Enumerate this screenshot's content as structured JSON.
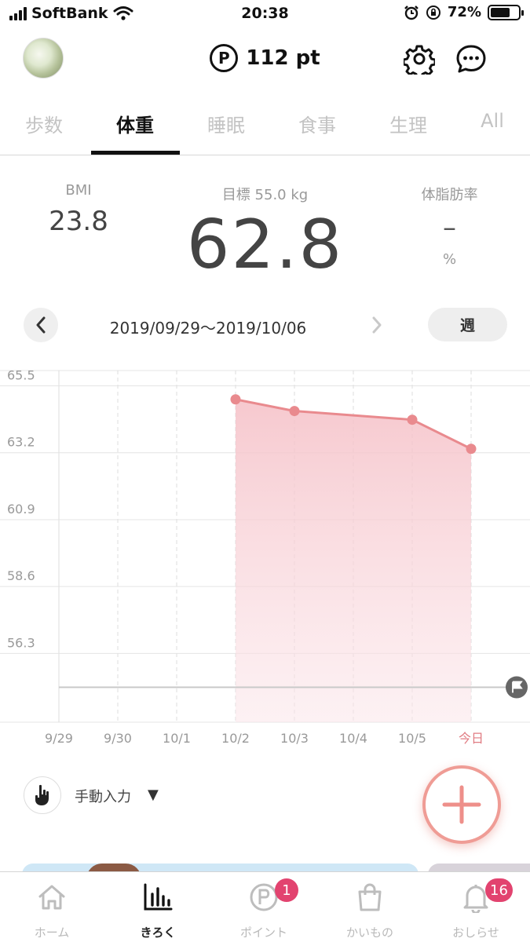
{
  "status_bar": {
    "carrier": "SoftBank",
    "time": "20:38",
    "battery_pct": "72%",
    "battery_level": 0.72
  },
  "header": {
    "points": "112 pt",
    "points_icon": "P"
  },
  "tabs": [
    {
      "label": "歩数"
    },
    {
      "label": "体重",
      "active": true
    },
    {
      "label": "睡眠"
    },
    {
      "label": "食事"
    },
    {
      "label": "生理"
    },
    {
      "label": "All"
    }
  ],
  "metrics": {
    "bmi_label": "BMI",
    "bmi_value": "23.8",
    "goal_label": "目標 55.0 kg",
    "weight_value": "62.8",
    "fat_label": "体脂肪率",
    "fat_value": "–",
    "fat_unit": "%"
  },
  "date_nav": {
    "range": "2019/09/29〜2019/10/06",
    "period": "週"
  },
  "chart_data": {
    "type": "area",
    "x": [
      "9/29",
      "9/30",
      "10/1",
      "10/2",
      "10/3",
      "10/4",
      "10/5",
      "今日"
    ],
    "y_ticks": [
      "65.5",
      "63.2",
      "60.9",
      "58.6",
      "56.3"
    ],
    "ylim": [
      53.8,
      66.0
    ],
    "goal": 55.0,
    "series": [
      {
        "points": [
          {
            "x": "10/2",
            "y": 64.9
          },
          {
            "x": "10/3",
            "y": 64.5
          },
          {
            "x": "10/5",
            "y": 64.2
          },
          {
            "x": "今日",
            "y": 63.2
          }
        ]
      }
    ],
    "colors": {
      "line": "#e98a8e",
      "fill": "#f7c9cf",
      "goal_line": "#c9c9c9",
      "today_label": "#e07b82"
    }
  },
  "manual": {
    "label": "手動入力",
    "arrow": "▼"
  },
  "bottom_nav": [
    {
      "label": "ホーム",
      "icon": "home-icon"
    },
    {
      "label": "きろく",
      "icon": "chart-icon",
      "active": true
    },
    {
      "label": "ポイント",
      "icon": "point-icon",
      "badge": "1"
    },
    {
      "label": "かいもの",
      "icon": "shopping-bag-icon"
    },
    {
      "label": "おしらせ",
      "icon": "bell-icon",
      "badge": "16"
    }
  ]
}
